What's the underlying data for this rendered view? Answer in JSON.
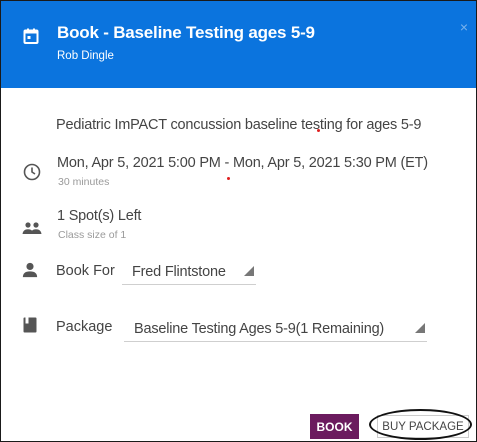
{
  "dialog": {
    "title": "Book - Baseline Testing ages 5-9",
    "subtitle": "Rob Dingle",
    "close_glyph": "×",
    "header_color": "#0b74de"
  },
  "description": "Pediatric ImPACT concussion baseline testing for ages 5-9",
  "schedule": {
    "icon": "clock-icon",
    "datetime": "Mon, Apr 5, 2021 5:00 PM - Mon, Apr 5, 2021 5:30 PM (ET)",
    "duration": "30 minutes"
  },
  "spots": {
    "icon": "people-icon",
    "left": "1 Spot(s) Left",
    "class_size": "Class size of 1"
  },
  "book_for": {
    "icon": "person-icon",
    "label": "Book For",
    "value": "Fred Flintstone"
  },
  "package": {
    "icon": "bookmark-icon",
    "label": "Package",
    "value": "Baseline Testing Ages 5-9(1 Remaining)"
  },
  "actions": {
    "book_label": "BOOK",
    "book_color": "#6b1b5e",
    "buy_package_label": "BUY PACKAGE"
  }
}
